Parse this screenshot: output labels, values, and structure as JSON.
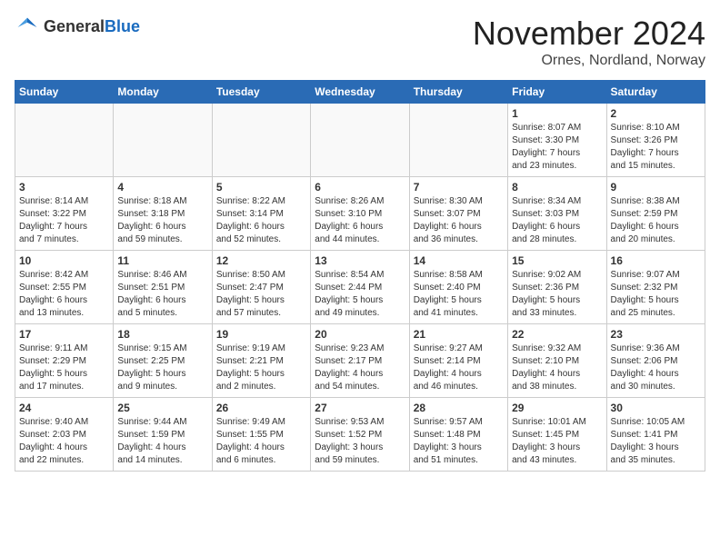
{
  "header": {
    "logo_general": "General",
    "logo_blue": "Blue",
    "month_title": "November 2024",
    "location": "Ornes, Nordland, Norway"
  },
  "weekdays": [
    "Sunday",
    "Monday",
    "Tuesday",
    "Wednesday",
    "Thursday",
    "Friday",
    "Saturday"
  ],
  "weeks": [
    [
      {
        "day": "",
        "info": ""
      },
      {
        "day": "",
        "info": ""
      },
      {
        "day": "",
        "info": ""
      },
      {
        "day": "",
        "info": ""
      },
      {
        "day": "",
        "info": ""
      },
      {
        "day": "1",
        "info": "Sunrise: 8:07 AM\nSunset: 3:30 PM\nDaylight: 7 hours\nand 23 minutes."
      },
      {
        "day": "2",
        "info": "Sunrise: 8:10 AM\nSunset: 3:26 PM\nDaylight: 7 hours\nand 15 minutes."
      }
    ],
    [
      {
        "day": "3",
        "info": "Sunrise: 8:14 AM\nSunset: 3:22 PM\nDaylight: 7 hours\nand 7 minutes."
      },
      {
        "day": "4",
        "info": "Sunrise: 8:18 AM\nSunset: 3:18 PM\nDaylight: 6 hours\nand 59 minutes."
      },
      {
        "day": "5",
        "info": "Sunrise: 8:22 AM\nSunset: 3:14 PM\nDaylight: 6 hours\nand 52 minutes."
      },
      {
        "day": "6",
        "info": "Sunrise: 8:26 AM\nSunset: 3:10 PM\nDaylight: 6 hours\nand 44 minutes."
      },
      {
        "day": "7",
        "info": "Sunrise: 8:30 AM\nSunset: 3:07 PM\nDaylight: 6 hours\nand 36 minutes."
      },
      {
        "day": "8",
        "info": "Sunrise: 8:34 AM\nSunset: 3:03 PM\nDaylight: 6 hours\nand 28 minutes."
      },
      {
        "day": "9",
        "info": "Sunrise: 8:38 AM\nSunset: 2:59 PM\nDaylight: 6 hours\nand 20 minutes."
      }
    ],
    [
      {
        "day": "10",
        "info": "Sunrise: 8:42 AM\nSunset: 2:55 PM\nDaylight: 6 hours\nand 13 minutes."
      },
      {
        "day": "11",
        "info": "Sunrise: 8:46 AM\nSunset: 2:51 PM\nDaylight: 6 hours\nand 5 minutes."
      },
      {
        "day": "12",
        "info": "Sunrise: 8:50 AM\nSunset: 2:47 PM\nDaylight: 5 hours\nand 57 minutes."
      },
      {
        "day": "13",
        "info": "Sunrise: 8:54 AM\nSunset: 2:44 PM\nDaylight: 5 hours\nand 49 minutes."
      },
      {
        "day": "14",
        "info": "Sunrise: 8:58 AM\nSunset: 2:40 PM\nDaylight: 5 hours\nand 41 minutes."
      },
      {
        "day": "15",
        "info": "Sunrise: 9:02 AM\nSunset: 2:36 PM\nDaylight: 5 hours\nand 33 minutes."
      },
      {
        "day": "16",
        "info": "Sunrise: 9:07 AM\nSunset: 2:32 PM\nDaylight: 5 hours\nand 25 minutes."
      }
    ],
    [
      {
        "day": "17",
        "info": "Sunrise: 9:11 AM\nSunset: 2:29 PM\nDaylight: 5 hours\nand 17 minutes."
      },
      {
        "day": "18",
        "info": "Sunrise: 9:15 AM\nSunset: 2:25 PM\nDaylight: 5 hours\nand 9 minutes."
      },
      {
        "day": "19",
        "info": "Sunrise: 9:19 AM\nSunset: 2:21 PM\nDaylight: 5 hours\nand 2 minutes."
      },
      {
        "day": "20",
        "info": "Sunrise: 9:23 AM\nSunset: 2:17 PM\nDaylight: 4 hours\nand 54 minutes."
      },
      {
        "day": "21",
        "info": "Sunrise: 9:27 AM\nSunset: 2:14 PM\nDaylight: 4 hours\nand 46 minutes."
      },
      {
        "day": "22",
        "info": "Sunrise: 9:32 AM\nSunset: 2:10 PM\nDaylight: 4 hours\nand 38 minutes."
      },
      {
        "day": "23",
        "info": "Sunrise: 9:36 AM\nSunset: 2:06 PM\nDaylight: 4 hours\nand 30 minutes."
      }
    ],
    [
      {
        "day": "24",
        "info": "Sunrise: 9:40 AM\nSunset: 2:03 PM\nDaylight: 4 hours\nand 22 minutes."
      },
      {
        "day": "25",
        "info": "Sunrise: 9:44 AM\nSunset: 1:59 PM\nDaylight: 4 hours\nand 14 minutes."
      },
      {
        "day": "26",
        "info": "Sunrise: 9:49 AM\nSunset: 1:55 PM\nDaylight: 4 hours\nand 6 minutes."
      },
      {
        "day": "27",
        "info": "Sunrise: 9:53 AM\nSunset: 1:52 PM\nDaylight: 3 hours\nand 59 minutes."
      },
      {
        "day": "28",
        "info": "Sunrise: 9:57 AM\nSunset: 1:48 PM\nDaylight: 3 hours\nand 51 minutes."
      },
      {
        "day": "29",
        "info": "Sunrise: 10:01 AM\nSunset: 1:45 PM\nDaylight: 3 hours\nand 43 minutes."
      },
      {
        "day": "30",
        "info": "Sunrise: 10:05 AM\nSunset: 1:41 PM\nDaylight: 3 hours\nand 35 minutes."
      }
    ]
  ]
}
